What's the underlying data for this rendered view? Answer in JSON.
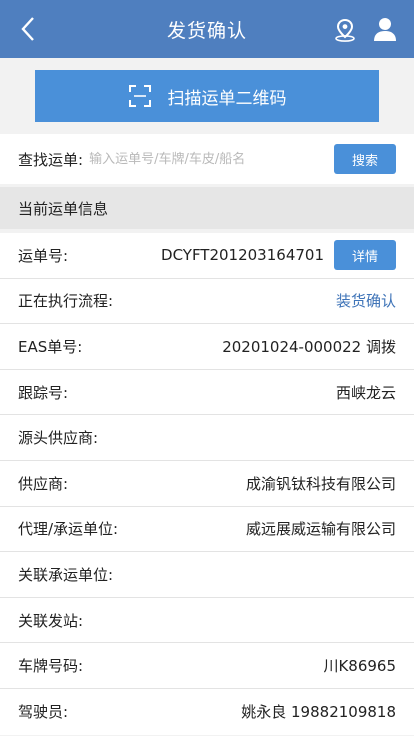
{
  "header": {
    "title": "发货确认",
    "back_icon": "chevron-left-icon",
    "location_icon": "map-pin-icon",
    "user_icon": "user-icon"
  },
  "scan": {
    "label": "扫描运单二维码",
    "icon": "scan-frame-icon"
  },
  "search": {
    "label": "查找运单:",
    "placeholder": "输入运单号/车牌/车皮/船名",
    "value": "",
    "button_label": "搜索"
  },
  "section": {
    "title": "当前运单信息"
  },
  "rows": [
    {
      "label": "运单号:",
      "value": "DCYFT201203164701",
      "button": "详情"
    },
    {
      "label": "正在执行流程:",
      "value": "装货确认"
    },
    {
      "label": "EAS单号:",
      "value": "20201024-000022 调拨"
    },
    {
      "label": "跟踪号:",
      "value": "西峡龙云"
    },
    {
      "label": "源头供应商:",
      "value": ""
    },
    {
      "label": "供应商:",
      "value": "成渝钒钛科技有限公司"
    },
    {
      "label": "代理/承运单位:",
      "value": "威远展威运输有限公司"
    },
    {
      "label": "关联承运单位:",
      "value": ""
    },
    {
      "label": "关联发站:",
      "value": ""
    },
    {
      "label": "车牌号码:",
      "value": "川K86965"
    },
    {
      "label": "驾驶员:",
      "value": "姚永良 19882109818"
    }
  ],
  "colors": {
    "header": "#4f7fbf",
    "accent": "#4a90d9",
    "link": "#3f74b8"
  }
}
